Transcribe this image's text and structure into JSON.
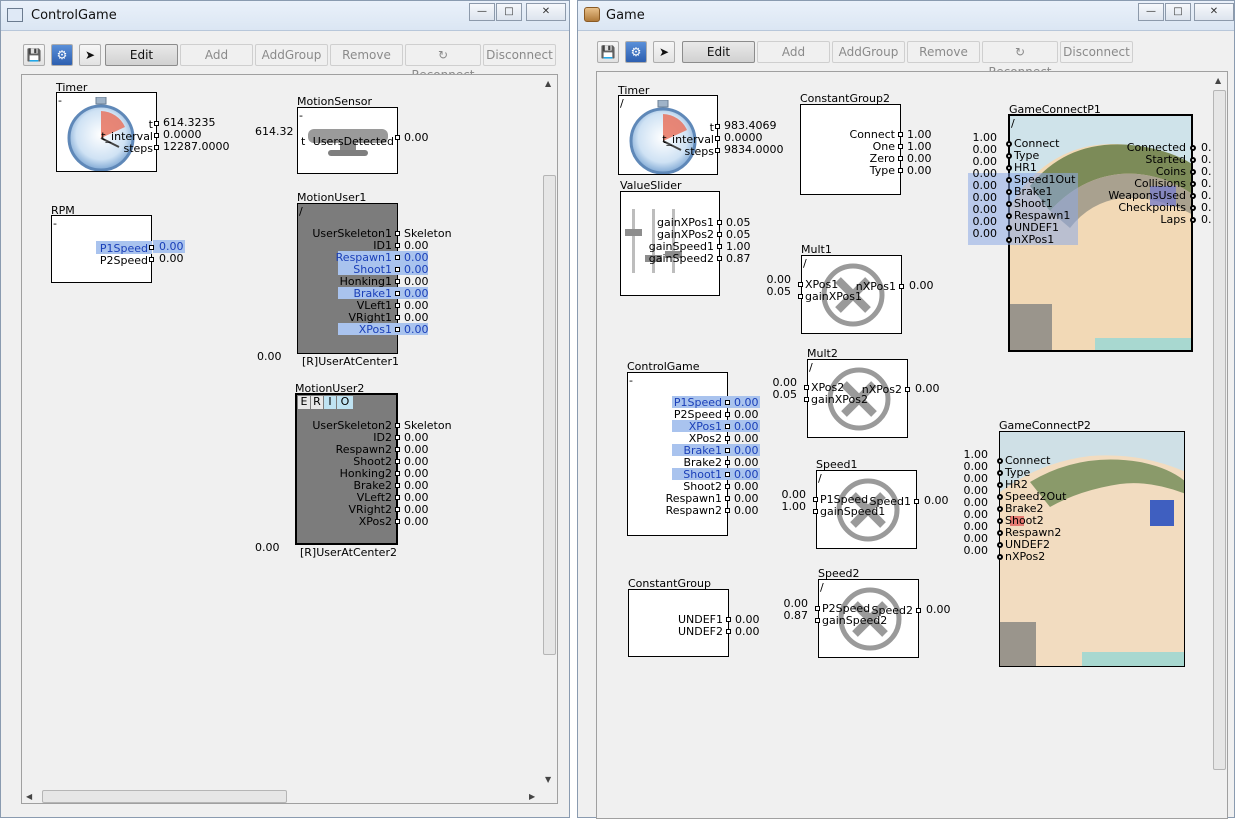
{
  "left": {
    "title": "ControlGame",
    "toolbar": {
      "edit": "Edit",
      "add": "Add",
      "addgroup": "AddGroup",
      "remove": "Remove",
      "reconnect": "Reconnect",
      "disconnect": "Disconnect"
    },
    "timer": {
      "title": "Timer",
      "tl": "-",
      "t_label": "t",
      "t_val": "614.3235",
      "interval_label": "t_interval",
      "interval_val": "0.0000",
      "steps_label": "steps",
      "steps_val": "12287.0000"
    },
    "motionsensor": {
      "title": "MotionSensor",
      "tl": "-",
      "in_val": "614.32",
      "in_label": "t",
      "out_label": "UsersDetected",
      "out_val": "0.00"
    },
    "rpm": {
      "title": "RPM",
      "tl": "-",
      "p1": "P1Speed",
      "p1_val": "0.00",
      "p2": "P2Speed",
      "p2_val": "0.00"
    },
    "motionuser1": {
      "title": "MotionUser1",
      "tl": "/",
      "ports": [
        "UserSkeleton1",
        "ID1",
        "Respawn1",
        "Shoot1",
        "Honking1",
        "Brake1",
        "VLeft1",
        "VRight1",
        "XPos1"
      ],
      "vals": [
        "Skeleton",
        "0.00",
        "0.00",
        "0.00",
        "0.00",
        "0.00",
        "0.00",
        "0.00",
        "0.00"
      ],
      "left_val": "0.00",
      "footer": "[R]UserAtCenter1"
    },
    "motionuser2": {
      "title": "MotionUser2",
      "tabs": [
        "E",
        "R",
        "I",
        "O"
      ],
      "ports": [
        "UserSkeleton2",
        "ID2",
        "Respawn2",
        "Shoot2",
        "Honking2",
        "Brake2",
        "VLeft2",
        "VRight2",
        "XPos2"
      ],
      "vals": [
        "Skeleton",
        "0.00",
        "0.00",
        "0.00",
        "0.00",
        "0.00",
        "0.00",
        "0.00",
        "0.00"
      ],
      "left_val": "0.00",
      "footer": "[R]UserAtCenter2"
    }
  },
  "right": {
    "title": "Game",
    "toolbar": {
      "edit": "Edit",
      "add": "Add",
      "addgroup": "AddGroup",
      "remove": "Remove",
      "reconnect": "Reconnect",
      "disconnect": "Disconnect"
    },
    "timer": {
      "title": "Timer",
      "tl": "/",
      "t_label": "t",
      "t_val": "983.4069",
      "interval_label": "t_interval",
      "interval_val": "0.0000",
      "steps_label": "steps",
      "steps_val": "9834.0000"
    },
    "valueslider": {
      "title": "ValueSlider",
      "ports": [
        "gainXPos1",
        "gainXPos2",
        "gainSpeed1",
        "gainSpeed2"
      ],
      "vals": [
        "0.05",
        "0.05",
        "1.00",
        "0.87"
      ]
    },
    "constantgroup2": {
      "title": "ConstantGroup2",
      "ports": [
        "Connect",
        "One",
        "Zero",
        "Type"
      ],
      "vals": [
        "1.00",
        "1.00",
        "0.00",
        "0.00"
      ]
    },
    "mult1": {
      "title": "Mult1",
      "tl": "/",
      "in": [
        "XPos1",
        "gainXPos1"
      ],
      "in_vals": [
        "0.00",
        "0.05"
      ],
      "out": "nXPos1",
      "out_val": "0.00"
    },
    "mult2": {
      "title": "Mult2",
      "tl": "/",
      "in": [
        "XPos2",
        "gainXPos2"
      ],
      "in_vals": [
        "0.00",
        "0.05"
      ],
      "out": "nXPos2",
      "out_val": "0.00"
    },
    "speed1": {
      "title": "Speed1",
      "tl": "/",
      "in": [
        "P1Speed",
        "gainSpeed1"
      ],
      "in_vals": [
        "0.00",
        "1.00"
      ],
      "out": "Speed1",
      "out_val": "0.00"
    },
    "speed2": {
      "title": "Speed2",
      "tl": "/",
      "in": [
        "P2Speed",
        "gainSpeed2"
      ],
      "in_vals": [
        "0.00",
        "0.87"
      ],
      "out": "Speed2",
      "out_val": "0.00"
    },
    "controlgame": {
      "title": "ControlGame",
      "tl": "-",
      "ports": [
        "P1Speed",
        "P2Speed",
        "XPos1",
        "XPos2",
        "Brake1",
        "Brake2",
        "Shoot1",
        "Shoot2",
        "Respawn1",
        "Respawn2"
      ],
      "vals": [
        "0.00",
        "0.00",
        "0.00",
        "0.00",
        "0.00",
        "0.00",
        "0.00",
        "0.00",
        "0.00",
        "0.00"
      ]
    },
    "constantgroup": {
      "title": "ConstantGroup",
      "ports": [
        "UNDEF1",
        "UNDEF2"
      ],
      "vals": [
        "0.00",
        "0.00"
      ]
    },
    "gameconnect1": {
      "title": "GameConnectP1",
      "tl": "/",
      "in": [
        "Connect",
        "Type",
        "HR1",
        "Speed1Out",
        "Brake1",
        "Shoot1",
        "Respawn1",
        "UNDEF1",
        "nXPos1"
      ],
      "in_vals": [
        "1.00",
        "0.00",
        "0.00",
        "0.00",
        "0.00",
        "0.00",
        "0.00",
        "0.00",
        "0.00"
      ],
      "out": [
        "Connected",
        "Started",
        "Coins",
        "Collisions",
        "WeaponsUsed",
        "Checkpoints",
        "Laps"
      ],
      "out_vals": [
        "0.",
        "0.",
        "0.",
        "0.",
        "0.",
        "0.",
        "0."
      ]
    },
    "gameconnect2": {
      "title": "GameConnectP2",
      "in": [
        "Connect",
        "Type",
        "HR2",
        "Speed2Out",
        "Brake2",
        "Shoot2",
        "Respawn2",
        "UNDEF2",
        "nXPos2"
      ],
      "in_vals": [
        "1.00",
        "0.00",
        "0.00",
        "0.00",
        "0.00",
        "0.00",
        "0.00",
        "0.00",
        "0.00"
      ]
    }
  }
}
